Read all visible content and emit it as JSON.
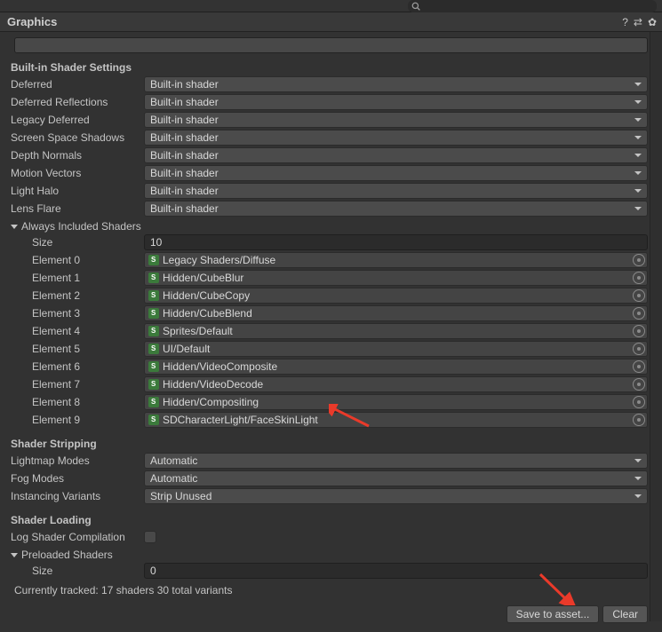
{
  "header": {
    "title": "Graphics"
  },
  "shaderSection": {
    "title": "Built-in Shader Settings",
    "rows": [
      {
        "label": "Deferred",
        "value": "Built-in shader"
      },
      {
        "label": "Deferred Reflections",
        "value": "Built-in shader"
      },
      {
        "label": "Legacy Deferred",
        "value": "Built-in shader"
      },
      {
        "label": "Screen Space Shadows",
        "value": "Built-in shader"
      },
      {
        "label": "Depth Normals",
        "value": "Built-in shader"
      },
      {
        "label": "Motion Vectors",
        "value": "Built-in shader"
      },
      {
        "label": "Light Halo",
        "value": "Built-in shader"
      },
      {
        "label": "Lens Flare",
        "value": "Built-in shader"
      }
    ]
  },
  "included": {
    "title": "Always Included Shaders",
    "sizeLabel": "Size",
    "size": "10",
    "elements": [
      {
        "label": "Element 0",
        "value": "Legacy Shaders/Diffuse"
      },
      {
        "label": "Element 1",
        "value": "Hidden/CubeBlur"
      },
      {
        "label": "Element 2",
        "value": "Hidden/CubeCopy"
      },
      {
        "label": "Element 3",
        "value": "Hidden/CubeBlend"
      },
      {
        "label": "Element 4",
        "value": "Sprites/Default"
      },
      {
        "label": "Element 5",
        "value": "UI/Default"
      },
      {
        "label": "Element 6",
        "value": "Hidden/VideoComposite"
      },
      {
        "label": "Element 7",
        "value": "Hidden/VideoDecode"
      },
      {
        "label": "Element 8",
        "value": "Hidden/Compositing"
      },
      {
        "label": "Element 9",
        "value": "SDCharacterLight/FaceSkinLight"
      }
    ]
  },
  "stripping": {
    "title": "Shader Stripping",
    "lightmap": {
      "label": "Lightmap Modes",
      "value": "Automatic"
    },
    "fog": {
      "label": "Fog Modes",
      "value": "Automatic"
    },
    "instancing": {
      "label": "Instancing Variants",
      "value": "Strip Unused"
    }
  },
  "loading": {
    "title": "Shader Loading",
    "logLabel": "Log Shader Compilation",
    "preloaded": {
      "title": "Preloaded Shaders",
      "sizeLabel": "Size",
      "size": "0"
    },
    "tracked": "Currently tracked: 17 shaders 30 total variants"
  },
  "footer": {
    "save": "Save to asset...",
    "clear": "Clear"
  }
}
